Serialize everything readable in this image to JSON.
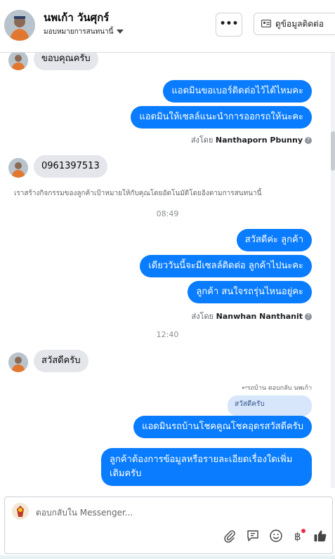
{
  "header": {
    "name": "นพเก้า วันศุกร์",
    "assign_label": "มอบหมายการสนทนานี้",
    "more_label": "•••",
    "contact_label": "ดูข้อมูลติดต่อ"
  },
  "messages": {
    "m1": "ขอบคุณครับ",
    "m2": "แอดมินขอเบอร์ติดต่อไว้ได้ไหมคะ",
    "m3": "แอดมินให้เซลล์แนะนำการออกรถให้นะคะ",
    "sent1_prefix": "ส่งโดย",
    "sent1_name": "Nanthaporn Pbunny",
    "m4": "0961397513",
    "system_text": "เราสร้างกิจกรรมของลูกค้าเป้าหมายให้กับคุณโดยอัตโนมัติโดยอิงตามการสนทนานี้",
    "time1": "08:49",
    "m5": "สวัสดีค่ะ ลูกค้า",
    "m6": "เดียววันนี้จะมีเซลล์ติดต่อ ลูกค้าไปนะคะ",
    "m7": "ลูกค้า สนใจรถรุ่นไหนอยู่คะ",
    "sent2_prefix": "ส่งโดย",
    "sent2_name": "Nanwhan Nanthanit",
    "time2": "12:40",
    "m8": "สวัสดีครับ",
    "reply_context": "รถบ้าน ตอบกลับ นพเก้า",
    "reply_quote": "สวัสดีครับ",
    "m9": "แอดมินรถบ้านโชคคูณโชคอุดรสวัสดีครับ",
    "m10": "ลูกค้าต้องการข้อมูลหรือรายละเอียดเรื่องใดเพิ่มเติมครับ"
  },
  "composer": {
    "placeholder": "ตอบกลับใน Messenger..."
  },
  "colors": {
    "accent": "#0a7cff",
    "incoming_bubble": "#e4e6eb",
    "quote_bubble": "#d8e6fb"
  },
  "icons": [
    "paperclip-icon",
    "saved-reply-icon",
    "emoji-icon",
    "baht-payment-icon",
    "thumbs-up-icon",
    "contact-card-icon",
    "caret-down-icon",
    "help-icon"
  ]
}
